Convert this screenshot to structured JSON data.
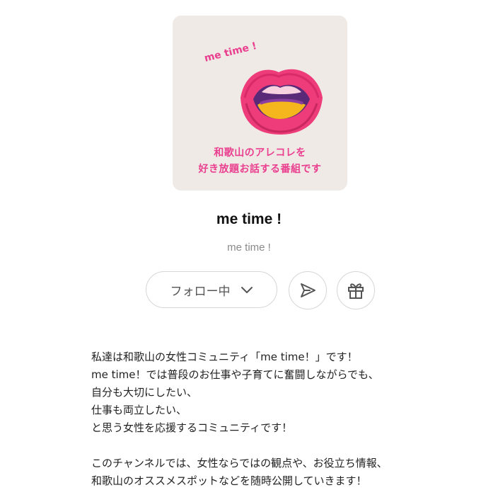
{
  "cover": {
    "tag": "me time !",
    "caption_line1": "和歌山のアレコレを",
    "caption_line2": "好き放題お話する番組です",
    "colors": {
      "background": "#efeae6",
      "accent": "#ea3f8f"
    }
  },
  "channel": {
    "title": "me time !",
    "subtitle": "me time !"
  },
  "actions": {
    "follow_label": "フォロー中",
    "follow_icon": "chevron-down-icon",
    "share_icon": "send-icon",
    "gift_icon": "gift-icon"
  },
  "description": {
    "lines": [
      "私達は和歌山の女性コミュニティ「me time！」です！",
      "me time！では普段のお仕事や子育てに奮闘しながらでも、",
      "自分も大切にしたい、",
      "仕事も両立したい、",
      "と思う女性を応援するコミュニティです！",
      "",
      "このチャンネルでは、女性ならではの観点や、お役立ち情報、",
      "和歌山のオススメスポットなどを随時公開していきます！"
    ]
  }
}
